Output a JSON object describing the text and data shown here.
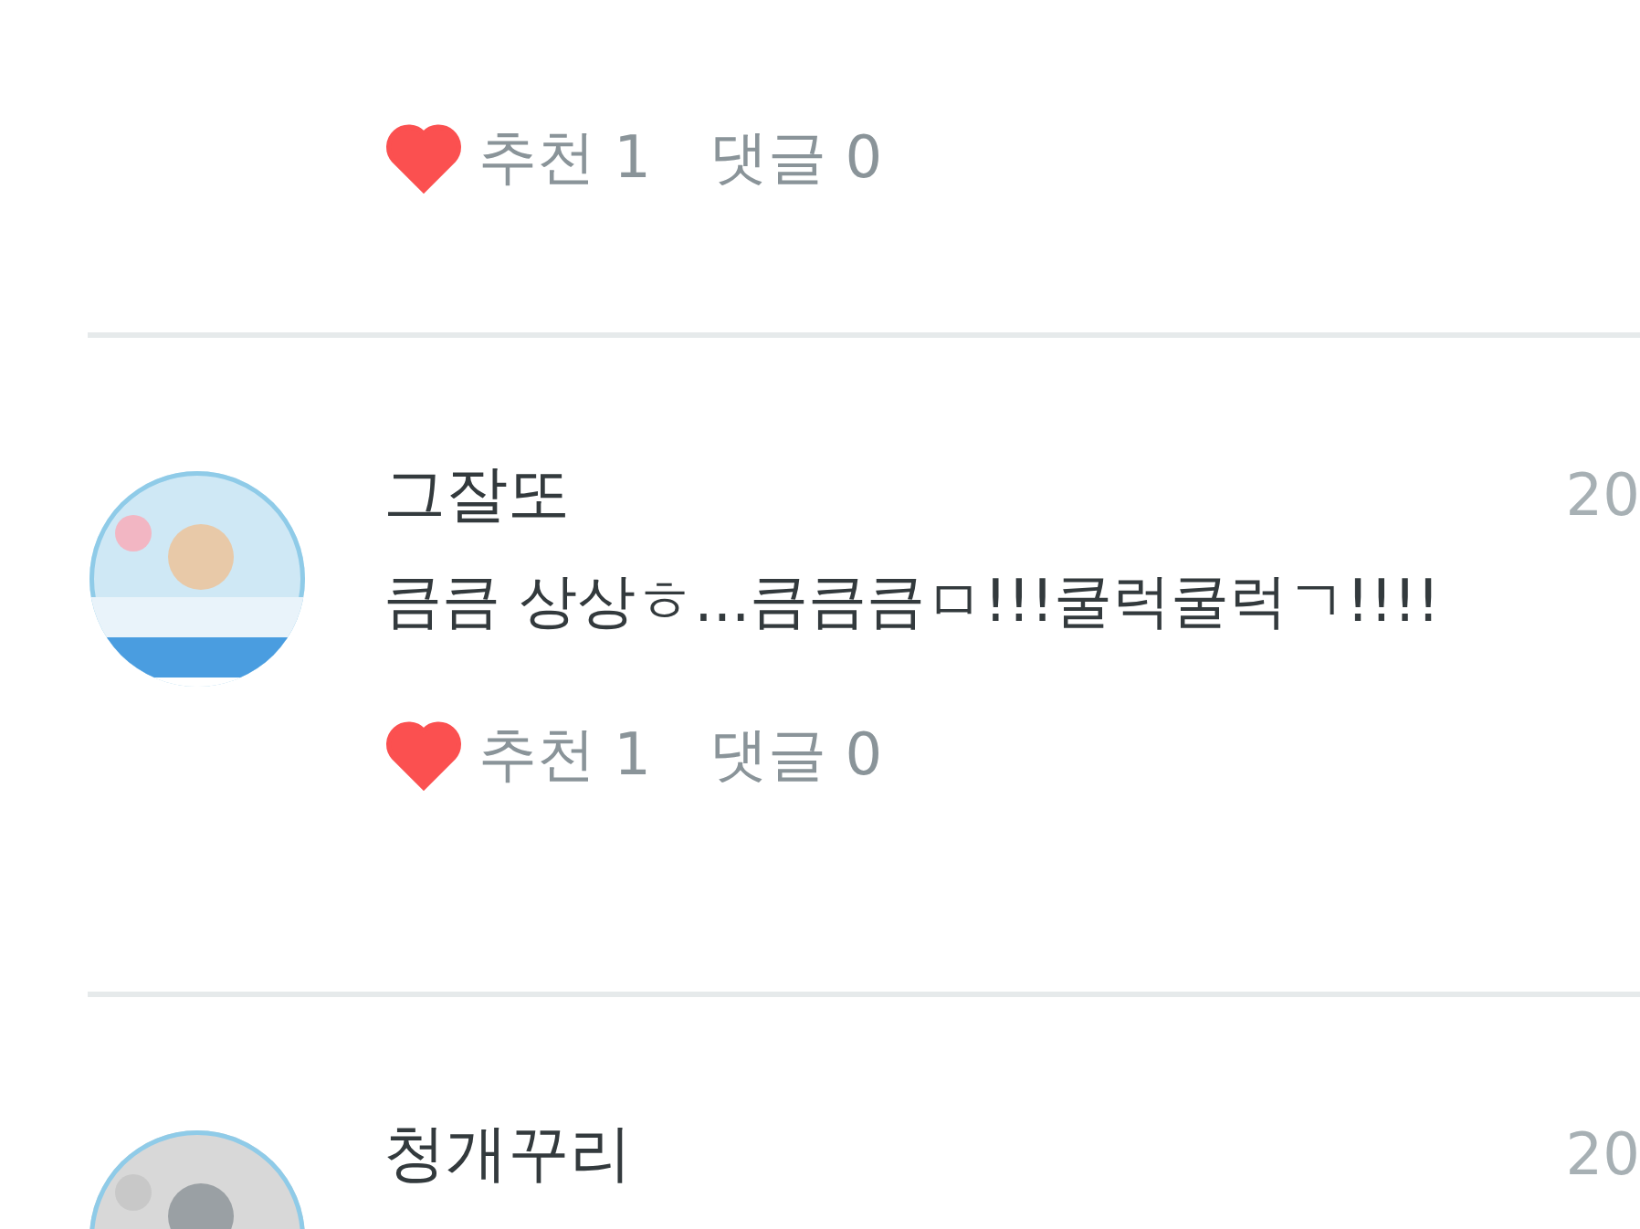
{
  "comments": [
    {
      "actions": {
        "liked": true,
        "like_label": "추천 1",
        "reply_label": "댓글 0"
      }
    },
    {
      "author": "그잘또",
      "date": "20",
      "text": "큼큼 상상ㅎ...큼큼큼ㅁ!!!쿨럭쿨럭ㄱ!!!!",
      "actions": {
        "liked": true,
        "like_label": "추천 1",
        "reply_label": "댓글 0"
      }
    },
    {
      "author": "청개꾸리",
      "date": "20"
    }
  ]
}
